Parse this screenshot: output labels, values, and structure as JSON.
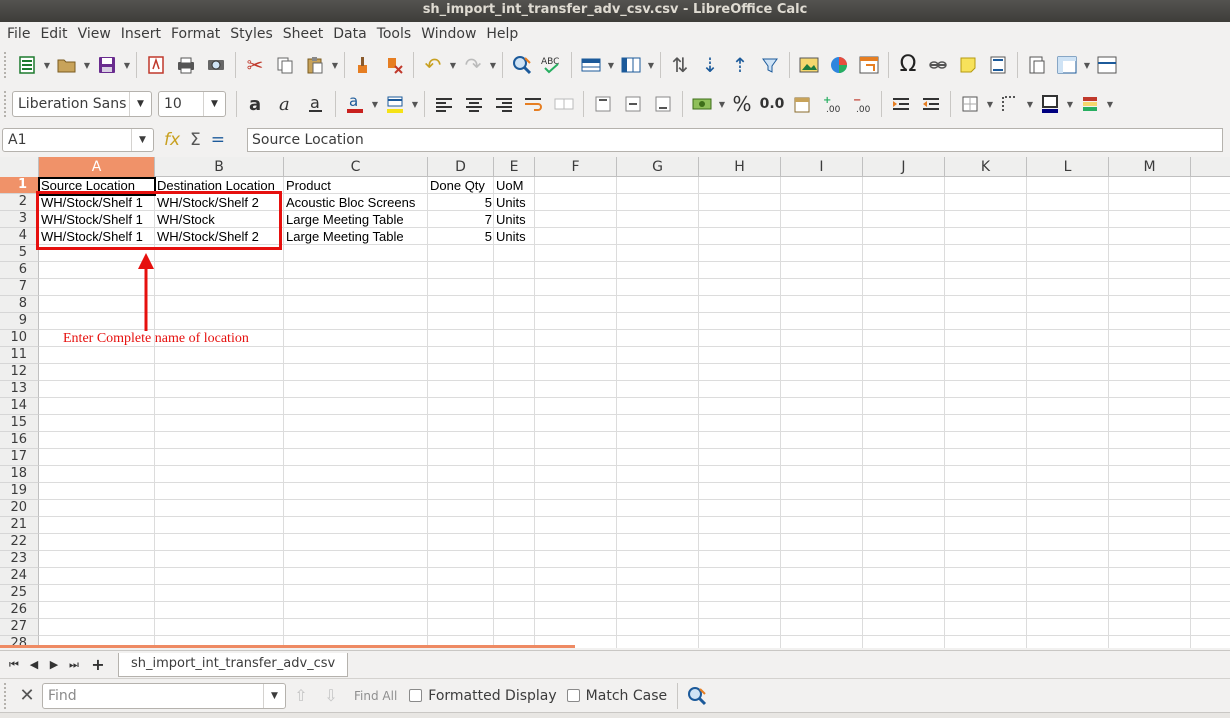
{
  "window": {
    "title": "sh_import_int_transfer_adv_csv.csv - LibreOffice Calc"
  },
  "menu": [
    "File",
    "Edit",
    "View",
    "Insert",
    "Format",
    "Styles",
    "Sheet",
    "Data",
    "Tools",
    "Window",
    "Help"
  ],
  "format_toolbar": {
    "font_name": "Liberation Sans",
    "font_size": "10",
    "percent_label": "%",
    "decimal_label": "0.0"
  },
  "formula_bar": {
    "name_box": "A1",
    "content": "Source Location"
  },
  "columns": [
    "A",
    "B",
    "C",
    "D",
    "E",
    "F",
    "G",
    "H",
    "I",
    "J",
    "K",
    "L",
    "M"
  ],
  "rows": [
    "1",
    "2",
    "3",
    "4",
    "5",
    "6",
    "7",
    "8",
    "9",
    "10",
    "11",
    "12",
    "13",
    "14",
    "15",
    "16",
    "17",
    "18",
    "19",
    "20",
    "21",
    "22",
    "23",
    "24",
    "25",
    "26",
    "27",
    "28"
  ],
  "cells": {
    "header": [
      "Source Location",
      "Destination Location",
      "Product",
      "Done Qty",
      "UoM"
    ],
    "data": [
      [
        "WH/Stock/Shelf 1",
        "WH/Stock/Shelf 2",
        "Acoustic Bloc Screens",
        "5",
        "Units"
      ],
      [
        "WH/Stock/Shelf 1",
        "WH/Stock",
        "Large Meeting Table",
        "7",
        "Units"
      ],
      [
        "WH/Stock/Shelf 1",
        "WH/Stock/Shelf 2",
        "Large Meeting Table",
        "5",
        "Units"
      ]
    ]
  },
  "annotation": {
    "text": "Enter Complete name of location",
    "color": "#e6100e"
  },
  "sheet_tabs": [
    "sh_import_int_transfer_adv_csv"
  ],
  "find_bar": {
    "placeholder": "Find",
    "find_all": "Find All",
    "formatted_display": "Formatted Display",
    "match_case": "Match Case"
  },
  "colors": {
    "accent": "#f09269",
    "annotation_red": "#e6100e"
  }
}
